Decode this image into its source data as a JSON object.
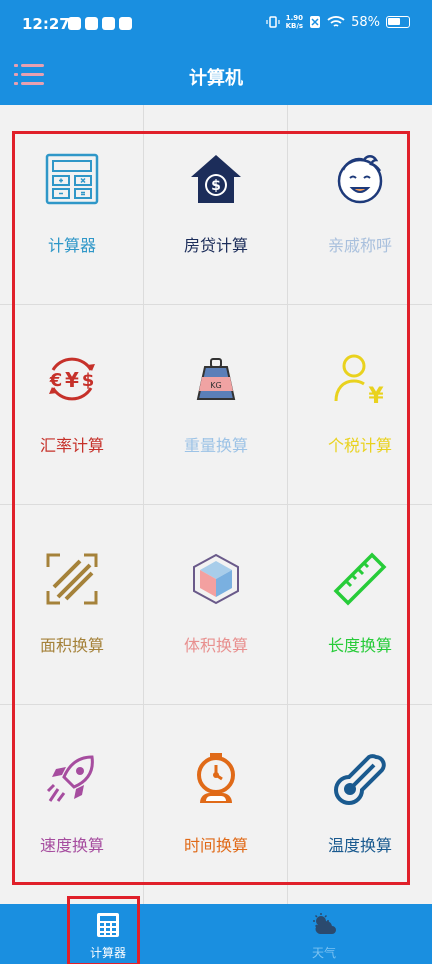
{
  "status_bar": {
    "time": "12:27",
    "speed_value": "1.90",
    "speed_unit": "KB/s",
    "battery": "58%"
  },
  "app_bar": {
    "title": "计算机",
    "menu_icon": "menu-icon"
  },
  "tools": [
    {
      "label": "计算器",
      "icon": "calculator-icon",
      "color": "#2f97c8"
    },
    {
      "label": "房贷计算",
      "icon": "house-loan-icon",
      "color": "#1c2d5a"
    },
    {
      "label": "亲戚称呼",
      "icon": "baby-face-icon",
      "color": "#a9c0dd"
    },
    {
      "label": "汇率计算",
      "icon": "currency-exchange-icon",
      "color": "#c6312a"
    },
    {
      "label": "重量换算",
      "icon": "weight-icon",
      "color": "#9dc3e6"
    },
    {
      "label": "个税计算",
      "icon": "personal-tax-icon",
      "color": "#e9d21e"
    },
    {
      "label": "面积换算",
      "icon": "area-icon",
      "color": "#a5823a"
    },
    {
      "label": "体积换算",
      "icon": "cube-icon",
      "color": "#e8908f"
    },
    {
      "label": "长度换算",
      "icon": "ruler-icon",
      "color": "#27cc39"
    },
    {
      "label": "速度换算",
      "icon": "rocket-icon",
      "color": "#a64d9f"
    },
    {
      "label": "时间换算",
      "icon": "stopwatch-icon",
      "color": "#e06a18"
    },
    {
      "label": "温度换算",
      "icon": "thermometer-icon",
      "color": "#1a5a8f"
    }
  ],
  "bottom_nav": {
    "items": [
      {
        "label": "计算器",
        "icon": "calculator-nav-icon",
        "active": true
      },
      {
        "label": "天气",
        "icon": "weather-icon",
        "active": false
      }
    ]
  },
  "colors": {
    "primary": "#1a8fe0",
    "highlight": "#e0202a",
    "background": "#f2f2f2"
  }
}
